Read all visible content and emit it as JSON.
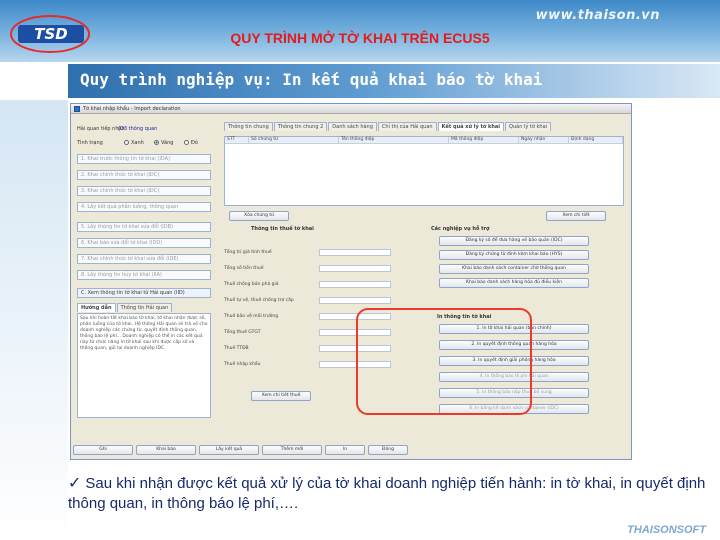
{
  "header": {
    "site": "www.thaison.vn",
    "slide_title": "QUY TRÌNH MỞ TỜ KHAI TRÊN ECUS5",
    "subtitle": "Quy trình nghiệp vụ: In kết quả khai báo tờ khai",
    "logo_text": "TSD"
  },
  "window": {
    "title": "Tờ khai nhập khẩu - Import declaration",
    "left_panel": {
      "row1_label": "Hải quan tiếp nhận",
      "row1_value": "(O3 thông quan",
      "row2_label": "Tình trạng",
      "radio_labels": [
        "Xanh",
        "Vàng",
        "Đỏ"
      ],
      "steps": [
        "1. Khai trước thông tin tờ khai (IDA)",
        "2. Khai chính thức tờ khai (IDC)",
        "3. Khai chính thức tờ khai (IDC)",
        "4. Lấy kết quả phân luồng, thông quan",
        "5. Lấy thông tin tờ khai sửa đổi (IDB)",
        "6. Khai báo sửa đổi tờ khai (IDD)",
        "7. Khai chính thức tờ khai sửa đổi (IDE)",
        "8. Lấy thông tin hủy tờ khai (IIA)"
      ],
      "active_step": "C. Xem thông tin tờ khai từ Hải quan (IID)",
      "tabs": [
        "Hướng dẫn",
        "Thông tin Hải quan"
      ],
      "notes": "Sau khi hoàn tất khai báo tờ khai, tờ khai nhận được số, phân luồng của tờ khai. Hệ thống Hải quan sẽ trả về cho doanh nghiệp các chứng từ, quyết định thông quan, thông báo lệ phí... Doanh nghiệp có thể in các kết quả này từ chức năng in tờ khai sau khi được cấp số và thông quan, gửi lại doanh nghiệp IDC."
    },
    "right_panel": {
      "tabs": [
        "Thông tin chung",
        "Thông tin chung 2",
        "Danh sách hàng",
        "Chỉ thị của Hải quan",
        "Kết quả xử lý tờ khai",
        "Quản lý tờ khai"
      ],
      "grid_headers": [
        "STT",
        "Số chứng từ",
        "Tên thông điệp",
        "Mã thông điệp",
        "Ngày nhận",
        "Định dạng"
      ],
      "grid_buttons": [
        "Xóa chứng từ",
        "Xem chi tiết"
      ],
      "group1_title": "Thông tin thuế tờ khai",
      "group1_rows": [
        "Tổng trị giá tính thuế",
        "Tổng số tiền thuế",
        "Thuế chống bán phá giá",
        "Thuế tự vệ, thuế chống trợ cấp",
        "Thuế bảo vệ môi trường",
        "Tổng thuế GTGT",
        "Thuế TTĐB",
        "Thuế nhập khẩu"
      ],
      "group1_button": "Xem chi tiết thuế",
      "group2_title": "Các nghiệp vụ hỗ trợ",
      "group2_buttons": [
        "Đăng ký số để đưa hàng về bảo quản (IDC)",
        "Đăng ký chứng từ đính kèm khai báo (HYS)",
        "Khai báo danh sách container chờ thông quan",
        "Khai báo danh sách hàng hóa đủ điều kiện"
      ],
      "print_group_title": "In thông tin tờ khai",
      "print_buttons": [
        "1. In tờ khai hải quan (bản chính)",
        "2. In quyết định thông quan hàng hóa",
        "3. In quyết định giải phóng hàng hóa",
        "4. In thông báo lệ phí hải quan",
        "5. In thông báo nộp thuế bổ sung",
        "6. In bảng kê danh sách container (IDC)"
      ],
      "bottom_buttons": [
        "Ghi",
        "Khai báo",
        "Lấy kết quả",
        "Thêm mới",
        "In",
        "Đóng"
      ]
    }
  },
  "bullet_text": "Sau khi nhận được kết quả xử lý của tờ khai doanh nghiệp tiến hành: in tờ khai, in quyết định thông quan, in thông báo lệ phí,….",
  "footer_brand": "THAISONSOFT",
  "colors": {
    "title_red": "#e61a1a",
    "highlight_oval": "#ec3a2a",
    "text_navy": "#152a6b",
    "band_blue": "#3d89c7"
  }
}
